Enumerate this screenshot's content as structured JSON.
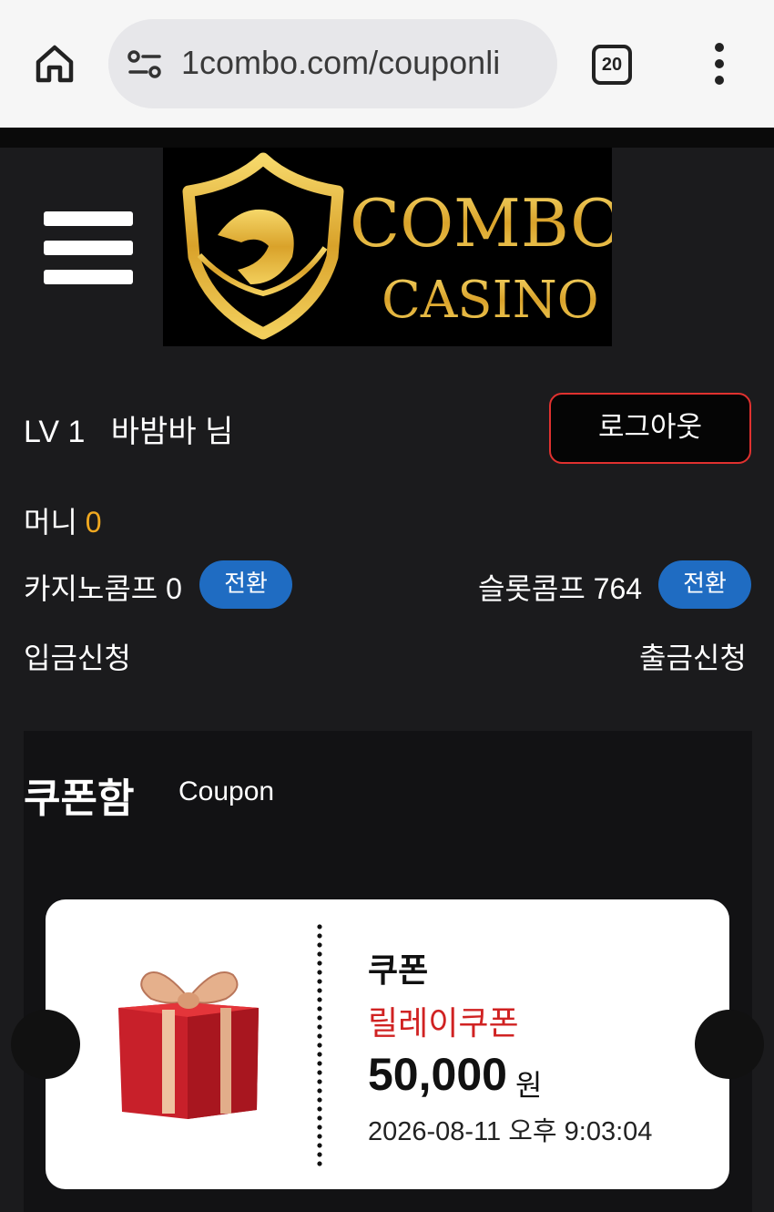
{
  "browser": {
    "url": "1combo.com/couponli",
    "tab_count": "20"
  },
  "logo": {
    "line1": "COMBO",
    "line2": "CASINO"
  },
  "user": {
    "level": "LV 1",
    "name": "바밤바 님",
    "logout_label": "로그아웃"
  },
  "balances": {
    "money_label": "머니",
    "money_value": "0",
    "casino_comp": "카지노콤프 0",
    "slot_comp": "슬롯콤프 764",
    "convert_label": "전환"
  },
  "links": {
    "deposit": "입금신청",
    "withdraw": "출금신청"
  },
  "coupon_box": {
    "title": "쿠폰함",
    "subtitle": "Coupon",
    "items": [
      {
        "label": "쿠폰",
        "type": "릴레이쿠폰",
        "amount": "50,000",
        "unit": "원",
        "date": "2026-08-11 오후 9:03:04"
      }
    ]
  },
  "colors": {
    "accent_money": "#f0a820",
    "convert_button": "#1f6cc2",
    "logout_border": "#e0312f",
    "coupon_type": "#d02222",
    "logo_gold": "#e2b43a"
  }
}
